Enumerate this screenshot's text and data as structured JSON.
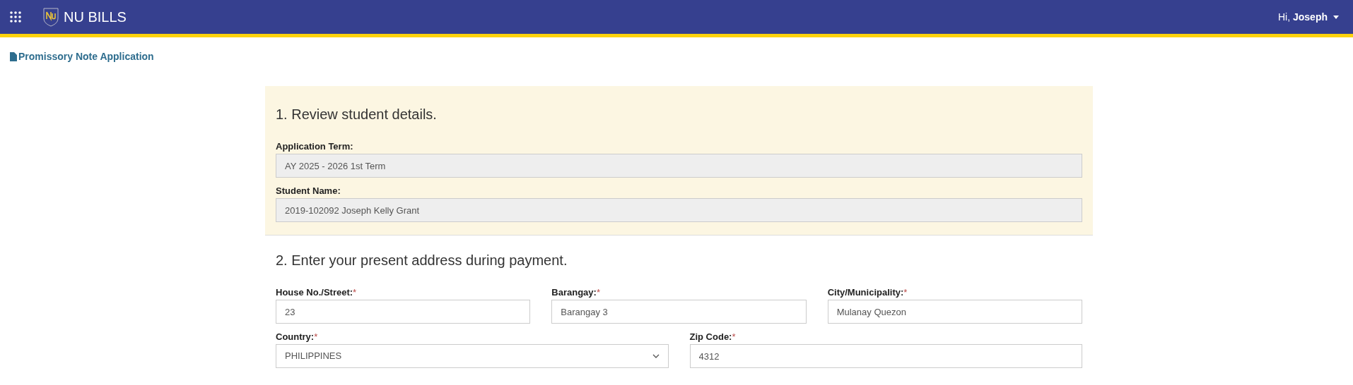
{
  "header": {
    "app_name": "NU BILLS",
    "greeting": "Hi,",
    "user": "Joseph"
  },
  "page_title": "Promissory Note Application",
  "review": {
    "heading": "1. Review student details.",
    "fields": [
      {
        "label": "Application Term:",
        "value": "AY 2025 - 2026 1st Term",
        "disabled": true
      },
      {
        "label": "Student Name:",
        "value": "2019-102092 Joseph Kelly Grant",
        "disabled": true
      }
    ]
  },
  "address": {
    "heading": "2. Enter your present address during payment.",
    "rows": [
      [
        {
          "label": "House No./Street:",
          "required_mark": "*",
          "kind": "text",
          "value": "23"
        },
        {
          "label": "Barangay:",
          "required_mark": "*",
          "kind": "text",
          "value": "Barangay 3"
        },
        {
          "label": "City/Municipality:",
          "required_mark": "*",
          "kind": "text",
          "value": "Mulanay Quezon"
        }
      ],
      [
        {
          "label": "Country:",
          "required_mark": "*",
          "kind": "select",
          "value": "PHILIPPINES"
        },
        {
          "label": "Zip Code:",
          "required_mark": "*",
          "kind": "text",
          "value": "4312"
        }
      ]
    ]
  }
}
